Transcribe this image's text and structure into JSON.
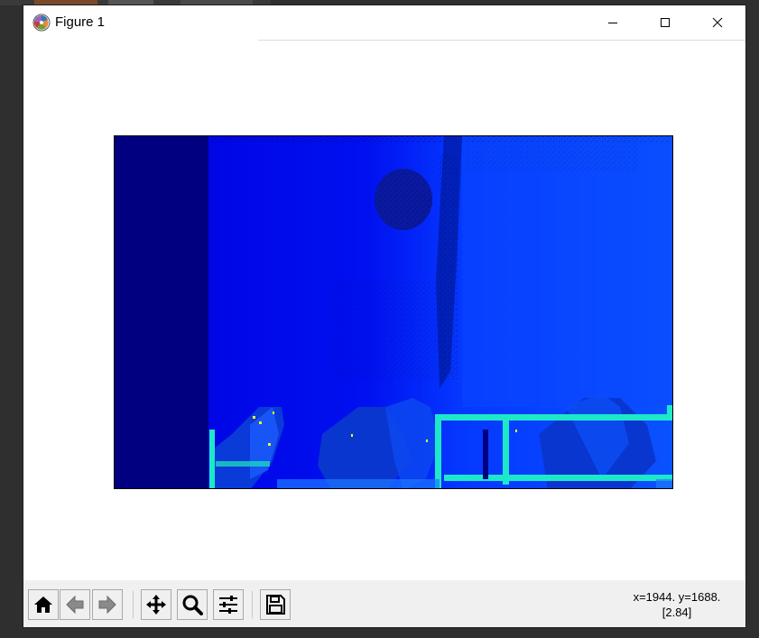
{
  "window": {
    "title": "Figure 1",
    "app_icon": "matplotlib-icon",
    "controls": [
      "minimize-icon",
      "maximize-icon",
      "close-icon"
    ]
  },
  "figure": {
    "image_description_colormap": "jet",
    "colors": {
      "deep_navy": "#000080",
      "blue": "#0000e6",
      "mid_blue": "#0a2cf0",
      "light_blue": "#0b4cff",
      "cyan": "#1de8c8",
      "yellow": "#f0ff20"
    }
  },
  "toolbar": {
    "buttons": [
      {
        "icon": "home-icon"
      },
      {
        "icon": "back-arrow-icon"
      },
      {
        "icon": "forward-arrow-icon"
      },
      {
        "icon": "pan-move-icon"
      },
      {
        "icon": "zoom-magnifier-icon"
      },
      {
        "icon": "configure-subplots-icon"
      },
      {
        "icon": "save-disk-icon"
      }
    ],
    "coords_line1": "x=1944. y=1688.",
    "coords_line2": "[2.84]"
  }
}
